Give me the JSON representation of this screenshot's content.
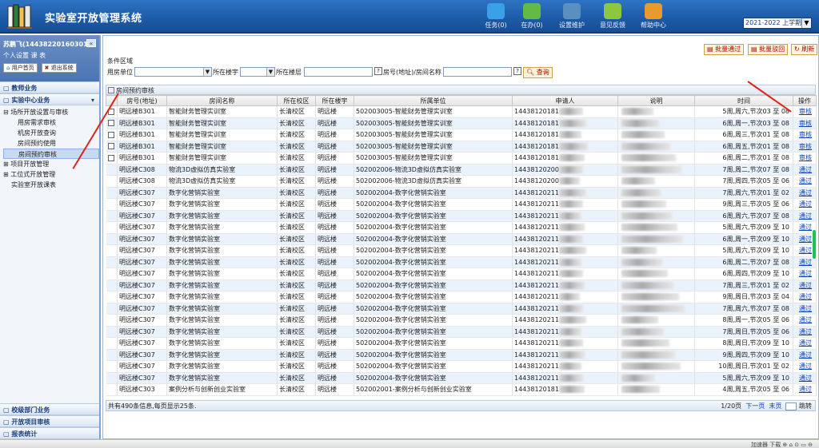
{
  "app": {
    "title": "实验室开放管理系统"
  },
  "topnav": [
    {
      "label": "任务(0)",
      "icon": "task-icon",
      "color": "#3aa0e8"
    },
    {
      "label": "在办(0)",
      "icon": "pen-icon",
      "color": "#65b947"
    },
    {
      "label": "设置维护",
      "icon": "settings-icon",
      "color": "#5b8fc2"
    },
    {
      "label": "意见反馈",
      "icon": "feedback-icon",
      "color": "#8dc63f"
    },
    {
      "label": "帮助中心",
      "icon": "help-book-icon",
      "color": "#e89a2f"
    }
  ],
  "term": {
    "selected": "2021-2022 上学期"
  },
  "user": {
    "name": "苏鹏飞(14438220160301)",
    "links": "个人设置 课 表",
    "home_label": "用户首页",
    "logout_label": "退出系统"
  },
  "sidebar": {
    "sections_top": [
      "教师业务",
      "实验中心业务"
    ],
    "tree": [
      {
        "label": "场所开放设置与审核",
        "level": 1,
        "prefix": "⊟"
      },
      {
        "label": "用房需求审核",
        "level": 2
      },
      {
        "label": "机房开放查询",
        "level": 2
      },
      {
        "label": "房间预约使用",
        "level": 2
      },
      {
        "label": "房间预约审核",
        "level": 2,
        "selected": true
      },
      {
        "label": "项目开放管理",
        "level": 1,
        "prefix": "⊞"
      },
      {
        "label": "工位式开放管理",
        "level": 1,
        "prefix": "⊞"
      },
      {
        "label": "实验室开放课表",
        "level": 1,
        "prefix": ""
      }
    ],
    "sections_bottom": [
      "校级部门业务",
      "开放项目审核",
      "报表统计"
    ]
  },
  "toolbar": {
    "batch_pass": "批量通过",
    "batch_reject": "批量驳回",
    "refresh": "刷新"
  },
  "filter": {
    "area_label": "条件区域",
    "unit_label": "用房单位",
    "campus_label": "所在楼宇",
    "floor_label": "所在楼层",
    "room_label": "房号(地址)/房间名称",
    "search_label": "查询"
  },
  "grid": {
    "title": "房间预约审核",
    "columns": [
      "",
      "房号(地址)",
      "房间名称",
      "所在校区",
      "所在楼宇",
      "所属单位",
      "申请人",
      "说明",
      "时间",
      "操作"
    ],
    "rows": [
      {
        "cb": true,
        "room": "明远楼B301",
        "name": "智能财务管理实训室",
        "campus": "长清校区",
        "bldg": "明远楼",
        "unit": "502003005-智能财务管理实训室",
        "app": "14438120181",
        "time": "5周,周六,节次03 至 08",
        "op": "审核"
      },
      {
        "cb": true,
        "room": "明远楼B301",
        "name": "智能财务管理实训室",
        "campus": "长清校区",
        "bldg": "明远楼",
        "unit": "502003005-智能财务管理实训室",
        "app": "14438120181",
        "time": "6周,周一,节次03 至 08",
        "op": "审核"
      },
      {
        "cb": true,
        "room": "明远楼B301",
        "name": "智能财务管理实训室",
        "campus": "长清校区",
        "bldg": "明远楼",
        "unit": "502003005-智能财务管理实训室",
        "app": "14438120181",
        "time": "6周,周三,节次01 至 08",
        "op": "审核"
      },
      {
        "cb": true,
        "room": "明远楼B301",
        "name": "智能财务管理实训室",
        "campus": "长清校区",
        "bldg": "明远楼",
        "unit": "502003005-智能财务管理实训室",
        "app": "14438120181",
        "time": "6周,周五,节次01 至 08",
        "op": "审核"
      },
      {
        "cb": true,
        "room": "明远楼B301",
        "name": "智能财务管理实训室",
        "campus": "长清校区",
        "bldg": "明远楼",
        "unit": "502003005-智能财务管理实训室",
        "app": "14438120181",
        "time": "6周,周二,节次01 至 08",
        "op": "审核"
      },
      {
        "cb": false,
        "room": "明远楼C308",
        "name": "物流3D虚拟仿真实验室",
        "campus": "长清校区",
        "bldg": "明远楼",
        "unit": "502002006-物流3D虚拟仿真实验室",
        "app": "14438120200",
        "time": "7周,周二,节次07 至 08",
        "op": "通过"
      },
      {
        "cb": false,
        "room": "明远楼C308",
        "name": "物流3D虚拟仿真实验室",
        "campus": "长清校区",
        "bldg": "明远楼",
        "unit": "502002006-物流3D虚拟仿真实验室",
        "app": "14438120200",
        "time": "7周,周四,节次05 至 06",
        "op": "通过"
      },
      {
        "cb": false,
        "room": "明远楼C307",
        "name": "数字化营销实验室",
        "campus": "长清校区",
        "bldg": "明远楼",
        "unit": "502002004-数字化营销实验室",
        "app": "14438120211",
        "time": "7周,周六,节次01 至 02",
        "op": "通过"
      },
      {
        "cb": false,
        "room": "明远楼C307",
        "name": "数字化营销实验室",
        "campus": "长清校区",
        "bldg": "明远楼",
        "unit": "502002004-数字化营销实验室",
        "app": "14438120211",
        "time": "9周,周三,节次05 至 06",
        "op": "通过"
      },
      {
        "cb": false,
        "room": "明远楼C307",
        "name": "数字化营销实验室",
        "campus": "长清校区",
        "bldg": "明远楼",
        "unit": "502002004-数字化营销实验室",
        "app": "14438120211",
        "time": "6周,周六,节次07 至 08",
        "op": "通过"
      },
      {
        "cb": false,
        "room": "明远楼C307",
        "name": "数字化营销实验室",
        "campus": "长清校区",
        "bldg": "明远楼",
        "unit": "502002004-数字化营销实验室",
        "app": "14438120211",
        "time": "5周,周六,节次09 至 10",
        "op": "通过"
      },
      {
        "cb": false,
        "room": "明远楼C307",
        "name": "数字化营销实验室",
        "campus": "长清校区",
        "bldg": "明远楼",
        "unit": "502002004-数字化营销实验室",
        "app": "14438120211",
        "time": "6周,周一,节次09 至 10",
        "op": "通过"
      },
      {
        "cb": false,
        "room": "明远楼C307",
        "name": "数字化营销实验室",
        "campus": "长清校区",
        "bldg": "明远楼",
        "unit": "502002004-数字化营销实验室",
        "app": "14438120211",
        "time": "5周,周六,节次09 至 10",
        "op": "通过"
      },
      {
        "cb": false,
        "room": "明远楼C307",
        "name": "数字化营销实验室",
        "campus": "长清校区",
        "bldg": "明远楼",
        "unit": "502002004-数字化营销实验室",
        "app": "14438120211",
        "time": "6周,周二,节次07 至 08",
        "op": "通过"
      },
      {
        "cb": false,
        "room": "明远楼C307",
        "name": "数字化营销实验室",
        "campus": "长清校区",
        "bldg": "明远楼",
        "unit": "502002004-数字化营销实验室",
        "app": "14438120211",
        "time": "6周,周四,节次09 至 10",
        "op": "通过"
      },
      {
        "cb": false,
        "room": "明远楼C307",
        "name": "数字化营销实验室",
        "campus": "长清校区",
        "bldg": "明远楼",
        "unit": "502002004-数字化营销实验室",
        "app": "14438120211",
        "time": "7周,周三,节次01 至 02",
        "op": "通过"
      },
      {
        "cb": false,
        "room": "明远楼C307",
        "name": "数字化营销实验室",
        "campus": "长清校区",
        "bldg": "明远楼",
        "unit": "502002004-数字化营销实验室",
        "app": "14438120211",
        "time": "9周,周日,节次03 至 04",
        "op": "通过"
      },
      {
        "cb": false,
        "room": "明远楼C307",
        "name": "数字化营销实验室",
        "campus": "长清校区",
        "bldg": "明远楼",
        "unit": "502002004-数字化营销实验室",
        "app": "14438120211",
        "time": "7周,周六,节次07 至 08",
        "op": "通过"
      },
      {
        "cb": false,
        "room": "明远楼C307",
        "name": "数字化营销实验室",
        "campus": "长清校区",
        "bldg": "明远楼",
        "unit": "502002004-数字化营销实验室",
        "app": "14438120211",
        "time": "8周,周一,节次05 至 06",
        "op": "通过"
      },
      {
        "cb": false,
        "room": "明远楼C307",
        "name": "数字化营销实验室",
        "campus": "长清校区",
        "bldg": "明远楼",
        "unit": "502002004-数字化营销实验室",
        "app": "14438120211",
        "time": "7周,周日,节次05 至 06",
        "op": "通过"
      },
      {
        "cb": false,
        "room": "明远楼C307",
        "name": "数字化营销实验室",
        "campus": "长清校区",
        "bldg": "明远楼",
        "unit": "502002004-数字化营销实验室",
        "app": "14438120211",
        "time": "8周,周日,节次09 至 10",
        "op": "通过"
      },
      {
        "cb": false,
        "room": "明远楼C307",
        "name": "数字化营销实验室",
        "campus": "长清校区",
        "bldg": "明远楼",
        "unit": "502002004-数字化营销实验室",
        "app": "14438120211",
        "time": "9周,周四,节次09 至 10",
        "op": "通过"
      },
      {
        "cb": false,
        "room": "明远楼C307",
        "name": "数字化营销实验室",
        "campus": "长清校区",
        "bldg": "明远楼",
        "unit": "502002004-数字化营销实验室",
        "app": "14438120211",
        "time": "10周,周日,节次01 至 02",
        "op": "通过"
      },
      {
        "cb": false,
        "room": "明远楼C307",
        "name": "数字化营销实验室",
        "campus": "长清校区",
        "bldg": "明远楼",
        "unit": "502002004-数字化营销实验室",
        "app": "14438120211",
        "time": "5周,周六,节次09 至 10",
        "op": "通过"
      },
      {
        "cb": false,
        "room": "明远楼C303",
        "name": "案例分析与创新创业实验室",
        "campus": "长清校区",
        "bldg": "明远楼",
        "unit": "502002001-案例分析与创新创业实验室",
        "app": "14438120181",
        "time": "4周,周五,节次05 至 06",
        "op": "通过"
      }
    ]
  },
  "footer": {
    "summary": "共有490条信息,每页显示25条.",
    "page": "1/20页",
    "next": "下一页",
    "last": "末页",
    "jump": "跳转"
  },
  "statusbar": {
    "right": "加速器  下载  ⊕  ⌂  ⊙  ▭  ⊖"
  }
}
